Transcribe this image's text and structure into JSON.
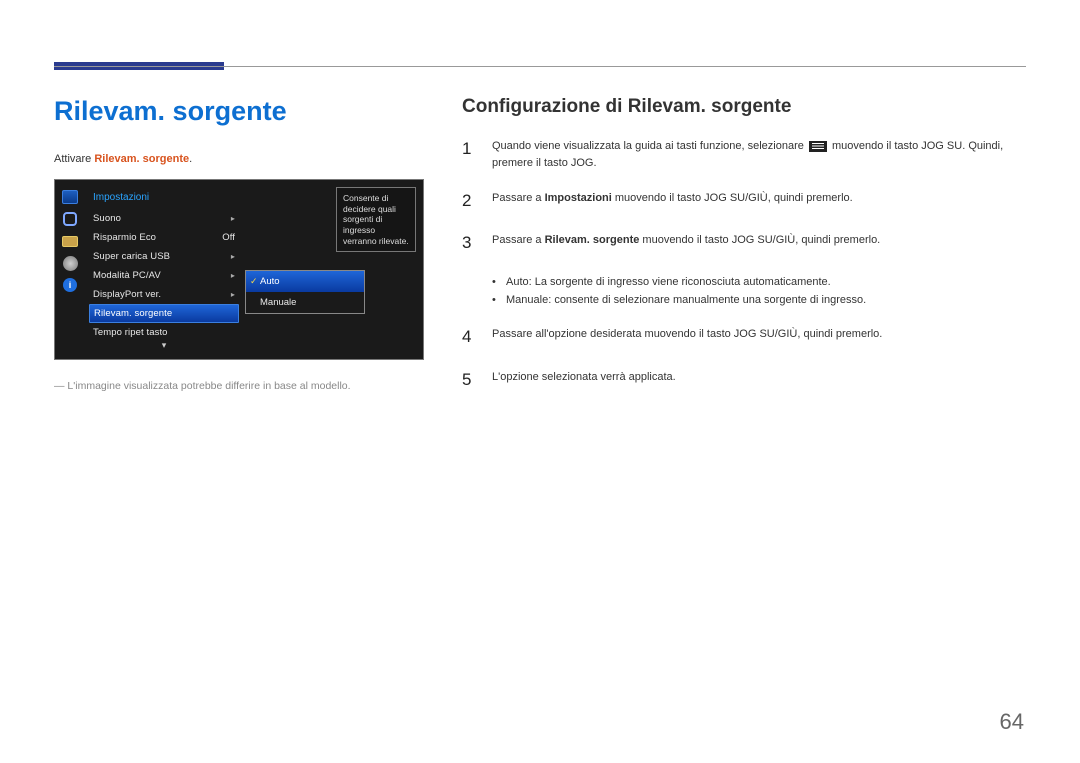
{
  "feature_title": "Rilevam. sorgente",
  "activate": {
    "prefix": "Attivare ",
    "strong": "Rilevam. sorgente",
    "suffix": "."
  },
  "osd": {
    "menu_title": "Impostazioni",
    "items": [
      {
        "label": "Suono",
        "value": "",
        "caret": true
      },
      {
        "label": "Risparmio Eco",
        "value": "Off",
        "caret": false
      },
      {
        "label": "Super carica USB",
        "value": "",
        "caret": true
      },
      {
        "label": "Modalità PC/AV",
        "value": "",
        "caret": true
      },
      {
        "label": "DisplayPort ver.",
        "value": "",
        "caret": true
      },
      {
        "label": "Rilevam. sorgente",
        "value": "",
        "caret": false,
        "selected": true
      },
      {
        "label": "Tempo ripet tasto",
        "value": "",
        "caret": false
      }
    ],
    "submenu": [
      {
        "label": "Auto",
        "selected": true
      },
      {
        "label": "Manuale",
        "selected": false
      }
    ],
    "tooltip": "Consente di decidere quali sorgenti di ingresso verranno rilevate."
  },
  "image_note": "L'immagine visualizzata potrebbe differire in base al modello.",
  "config_title": "Configurazione di Rilevam. sorgente",
  "steps": {
    "s1": {
      "num": "1",
      "pre": "Quando viene visualizzata la guida ai tasti funzione, selezionare ",
      "post": " muovendo il tasto JOG SU. Quindi, premere il tasto JOG."
    },
    "s2": {
      "num": "2",
      "pre": "Passare a ",
      "b": "Impostazioni",
      "post": " muovendo il tasto JOG SU/GIÙ, quindi premerlo."
    },
    "s3": {
      "num": "3",
      "pre": "Passare a ",
      "b": "Rilevam. sorgente",
      "post": " muovendo il tasto JOG SU/GIÙ, quindi premerlo."
    },
    "bullets": {
      "auto_label": "Auto",
      "auto_text": ": La sorgente di ingresso viene riconosciuta automaticamente.",
      "man_label": "Manuale",
      "man_text": ": consente di selezionare manualmente una sorgente di ingresso."
    },
    "s4": {
      "num": "4",
      "text": "Passare all'opzione desiderata muovendo il tasto JOG SU/GIÙ, quindi premerlo."
    },
    "s5": {
      "num": "5",
      "text": "L'opzione selezionata verrà applicata."
    }
  },
  "page_number": "64"
}
